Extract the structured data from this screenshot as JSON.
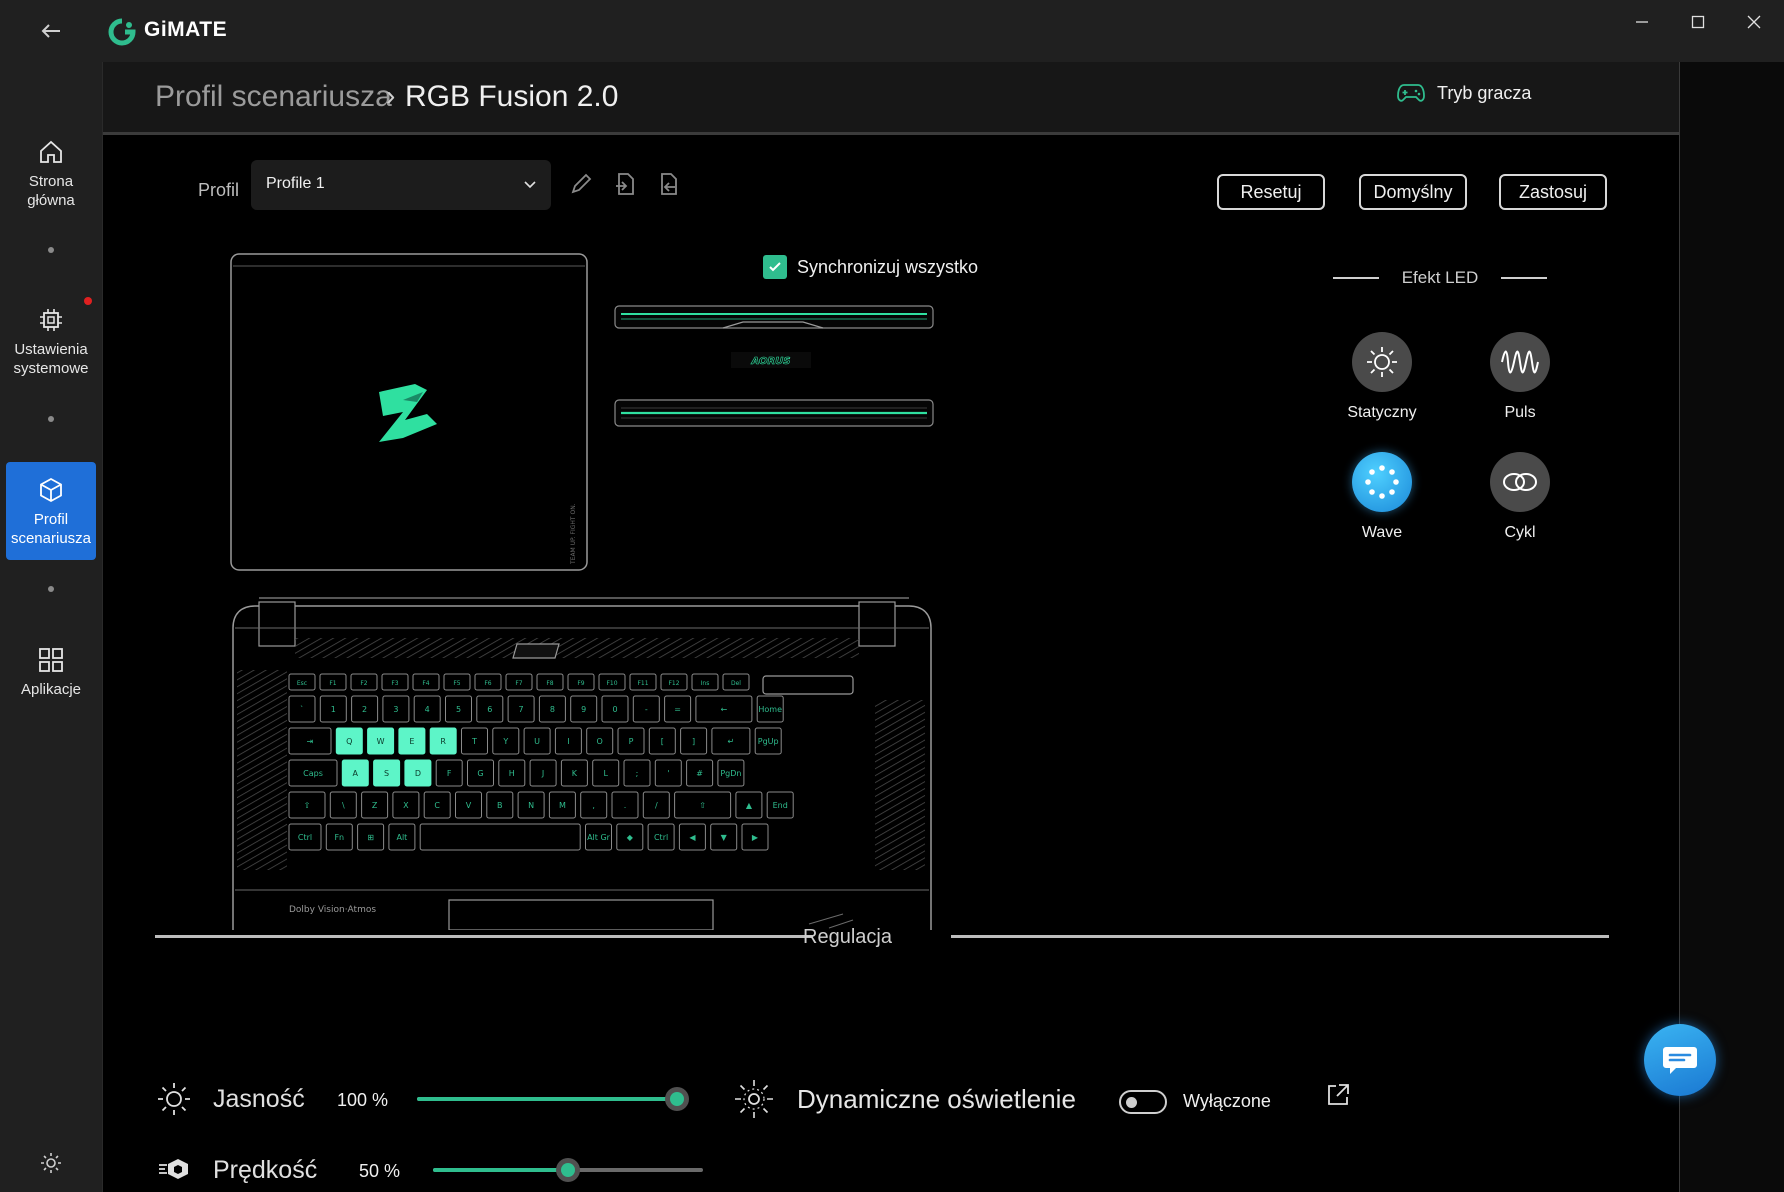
{
  "app": {
    "name": "GiMATE"
  },
  "sidebar": {
    "items": [
      {
        "label": "Strona główna",
        "icon": "home-icon"
      },
      {
        "label": "Ustawienia systemowe",
        "icon": "chip-icon"
      },
      {
        "label": "Profil scenariusza",
        "icon": "cube-icon",
        "active": true
      },
      {
        "label": "Aplikacje",
        "icon": "apps-grid-icon"
      }
    ],
    "settings_icon": "gear-icon"
  },
  "header": {
    "breadcrumb_parent": "Profil scenariusza",
    "breadcrumb_separator": "›",
    "breadcrumb_current": "RGB Fusion 2.0",
    "gamer_mode": "Tryb gracza"
  },
  "profile": {
    "label": "Profil",
    "selected": "Profile 1",
    "actions": [
      "edit-pencil-icon",
      "export-icon",
      "import-icon"
    ]
  },
  "buttons": {
    "reset": "Resetuj",
    "default": "Domyślny",
    "apply": "Zastosuj"
  },
  "sync": {
    "label": "Synchronizuj wszystko",
    "checked": true
  },
  "led_effects": {
    "title": "Efekt LED",
    "items": [
      {
        "label": "Statyczny",
        "icon": "sun-static-icon",
        "selected": false
      },
      {
        "label": "Puls",
        "icon": "pulse-wave-icon",
        "selected": false
      },
      {
        "label": "Wave",
        "icon": "wave-dots-icon",
        "selected": true
      },
      {
        "label": "Cykl",
        "icon": "cycle-rings-icon",
        "selected": false
      }
    ]
  },
  "keyboard": {
    "brand_text": "AORUS",
    "lid_text": "TEAM UP. FIGHT ON.",
    "dolby_text": "Dolby Vision·Atmos",
    "highlight_keys": [
      "Q",
      "W",
      "E",
      "R",
      "A",
      "S",
      "D"
    ],
    "rows": [
      [
        "Esc",
        "F1",
        "F2",
        "F3",
        "F4",
        "F5",
        "F6",
        "F7",
        "F8",
        "F9",
        "F10",
        "F11",
        "F12",
        "Ins",
        "Del"
      ],
      [
        "`",
        "1",
        "2",
        "3",
        "4",
        "5",
        "6",
        "7",
        "8",
        "9",
        "0",
        "-",
        "=",
        "←",
        "Home"
      ],
      [
        "⇥",
        "Q",
        "W",
        "E",
        "R",
        "T",
        "Y",
        "U",
        "I",
        "O",
        "P",
        "[",
        "]",
        "↵",
        "PgUp"
      ],
      [
        "Caps",
        "A",
        "S",
        "D",
        "F",
        "G",
        "H",
        "J",
        "K",
        "L",
        ";",
        "'",
        "#",
        "PgDn"
      ],
      [
        "⇧",
        "\\",
        "Z",
        "X",
        "C",
        "V",
        "B",
        "N",
        "M",
        ",",
        ".",
        "/",
        "⇧",
        "▲",
        "End"
      ],
      [
        "Ctrl",
        "Fn",
        "⊞",
        "Alt",
        "",
        "Alt Gr",
        "◆",
        "Ctrl",
        "◀",
        "▼",
        "▶"
      ]
    ]
  },
  "regulation": {
    "title": "Regulacja",
    "brightness": {
      "label": "Jasność",
      "value_text": "100 %",
      "value": 1.0,
      "icon": "sun-icon"
    },
    "speed": {
      "label": "Prędkość",
      "value_text": "50 %",
      "value": 0.5,
      "icon": "speed-icon"
    },
    "dynamic": {
      "label": "Dynamiczne oświetlenie",
      "state": "Wyłączone",
      "on": false,
      "icon": "dynamic-light-icon",
      "link_icon": "external-link-icon"
    }
  },
  "colors": {
    "accent": "#2fbd8e",
    "active_nav": "#1f6fd8",
    "background": "#000000"
  }
}
